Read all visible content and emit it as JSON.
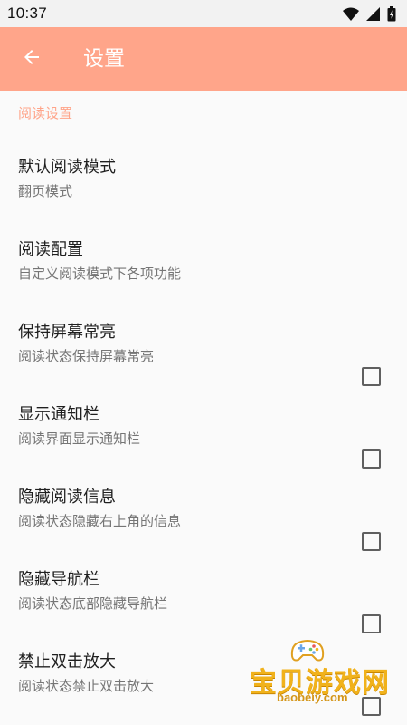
{
  "status_bar": {
    "time": "10:37",
    "icons": [
      "wifi-icon",
      "signal-icon",
      "battery-icon"
    ]
  },
  "app_bar": {
    "back_icon": "arrow-left-icon",
    "title": "设置",
    "background_color": "#ffa58a"
  },
  "section": {
    "title": "阅读设置",
    "accent_color": "#ffa58a"
  },
  "items": [
    {
      "title": "默认阅读模式",
      "summary": "翻页模式",
      "has_checkbox": false
    },
    {
      "title": "阅读配置",
      "summary": "自定义阅读模式下各项功能",
      "has_checkbox": false
    },
    {
      "title": "保持屏幕常亮",
      "summary": "阅读状态保持屏幕常亮",
      "has_checkbox": true,
      "checked": false
    },
    {
      "title": "显示通知栏",
      "summary": "阅读界面显示通知栏",
      "has_checkbox": true,
      "checked": false
    },
    {
      "title": "隐藏阅读信息",
      "summary": "阅读状态隐藏右上角的信息",
      "has_checkbox": true,
      "checked": false
    },
    {
      "title": "隐藏导航栏",
      "summary": "阅读状态底部隐藏导航栏",
      "has_checkbox": true,
      "checked": false
    },
    {
      "title": "禁止双击放大",
      "summary": "阅读状态禁止双击放大",
      "has_checkbox": true,
      "checked": false
    }
  ],
  "watermark": {
    "title": "宝贝游戏网",
    "url": "baobeiy.com"
  }
}
